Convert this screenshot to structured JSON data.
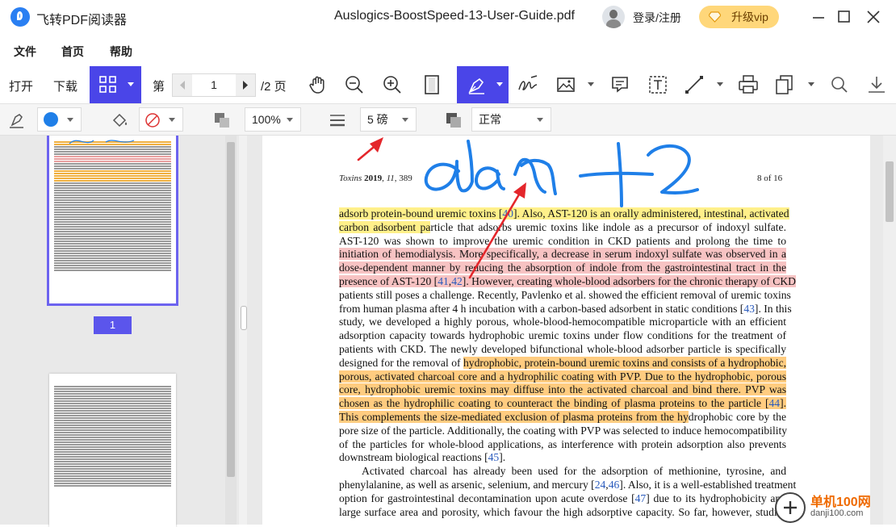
{
  "app": {
    "name": "飞转PDF阅读器",
    "document_title": "Auslogics-BoostSpeed-13-User-Guide.pdf",
    "login_label": "登录/注册",
    "vip_label": "升级vip"
  },
  "menu": [
    "文件",
    "首页",
    "帮助"
  ],
  "toolbar": {
    "open_label": "打开",
    "download_label": "下载",
    "page_prefix": "第",
    "page_value": "1",
    "page_total": "/2 页",
    "active_color": "#4a45e8"
  },
  "properties": {
    "stroke_color": "#1f7fe8",
    "opacity": "100%",
    "line_weight": "5 磅",
    "blend_mode": "正常"
  },
  "thumbnails": {
    "page_badge": "1"
  },
  "document": {
    "header_left": {
      "journal": "Toxins",
      "year": "2019",
      "volume": "11",
      "page": "389"
    },
    "header_right": "8 of 16",
    "lines": [
      [
        {
          "t": "adsorb protein-bound uremic toxins [",
          "h": "y"
        },
        {
          "t": "40",
          "h": "y",
          "ref": true
        },
        {
          "t": "].  Also, AST-120 is an orally administered, intestinal, activated",
          "h": "y"
        }
      ],
      [
        {
          "t": "carbon adsorbent pa",
          "h": "y"
        },
        {
          "t": "rticle that adsorbs uremic toxins like indole as a precursor of indoxyl sulfate."
        }
      ],
      [
        {
          "t": "AST-120 was shown to improve the uremic condition in CKD patients and prolong the time to"
        }
      ],
      [
        {
          "t": "initiation of hemodialysis.  More specifically, a decrease in serum indoxyl sulfate was observed in a",
          "h": "p"
        }
      ],
      [
        {
          "t": "dose-dependent manner by reducing the absorption of indole from the gastrointestinal tract in the",
          "h": "p"
        }
      ],
      [
        {
          "t": "presence of AST-120 [",
          "h": "p"
        },
        {
          "t": "41",
          "h": "p",
          "ref": true
        },
        {
          "t": ",",
          "h": "p"
        },
        {
          "t": "42",
          "h": "p",
          "ref": true
        },
        {
          "t": "]. However, creating whole-blood adsorbers for the chronic therapy of CKD",
          "h": "p"
        }
      ],
      [
        {
          "t": "patients still poses a challenge.  Recently, Pavlenko et al. showed the efficient removal of uremic toxins"
        }
      ],
      [
        {
          "t": "from human plasma after 4 h incubation with a carbon-based adsorbent in static conditions ["
        },
        {
          "t": "43",
          "ref": true
        },
        {
          "t": "]. In this"
        }
      ],
      [
        {
          "t": "study, we developed a highly porous, whole-blood-hemocompatible microparticle with an efficient"
        }
      ],
      [
        {
          "t": "adsorption capacity towards hydrophobic uremic toxins under flow conditions for the treatment of"
        }
      ],
      [
        {
          "t": "patients with CKD. The newly developed bifunctional whole-blood adsorber particle is specifically"
        }
      ],
      [
        {
          "t": "designed for the removal of "
        },
        {
          "t": "hydrophobic, protein-bound uremic toxins and consists of a hydrophobic,",
          "h": "o"
        }
      ],
      [
        {
          "t": "porous, activated charcoal core and a hydrophilic coating with PVP. Due to the hydrophobic, porous",
          "h": "o"
        }
      ],
      [
        {
          "t": "core, hydrophobic uremic toxins may diffuse into the activated charcoal and bind there.  PVP was",
          "h": "o"
        }
      ],
      [
        {
          "t": "chosen as the hydrophilic coating to counteract the binding of plasma proteins to the particle [",
          "h": "o"
        },
        {
          "t": "44",
          "h": "o",
          "ref": true
        },
        {
          "t": "].",
          "h": "o"
        }
      ],
      [
        {
          "t": "This complements the size-mediated exclusion of plasma proteins from the hy",
          "h": "o"
        },
        {
          "t": "drophobic core by the"
        }
      ],
      [
        {
          "t": "pore size of the particle.  Additionally, the coating with PVP was selected to induce hemocompatibility"
        }
      ],
      [
        {
          "t": "of the particles for whole-blood applications, as interference with protein adsorption also prevents"
        }
      ],
      [
        {
          "t": "downstream biological reactions ["
        },
        {
          "t": "45",
          "ref": true
        },
        {
          "t": "]."
        }
      ],
      [
        {
          "t": "Activated charcoal has already been used for the adsorption of methionine, tyrosine, and"
        }
      ],
      [
        {
          "t": "phenylalanine, as well as arsenic, selenium, and mercury ["
        },
        {
          "t": "24",
          "ref": true
        },
        {
          "t": ","
        },
        {
          "t": "46",
          "ref": true
        },
        {
          "t": "]. Also, it is a well-established treatment"
        }
      ],
      [
        {
          "t": "option for gastrointestinal decontamination upon acute overdose ["
        },
        {
          "t": "47",
          "ref": true
        },
        {
          "t": "] due to its hydrophobicity and"
        }
      ],
      [
        {
          "t": "large surface area and porosity, which favour the high adsorptive capacity. So far, however, studies"
        }
      ]
    ]
  },
  "handwriting": "dan +2",
  "watermark": {
    "title": "单机100网",
    "url": "danji100.com"
  }
}
